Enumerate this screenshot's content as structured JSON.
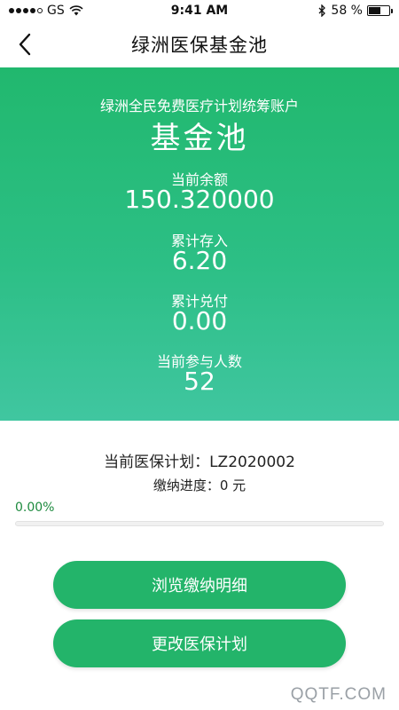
{
  "status_bar": {
    "carrier": "GS",
    "time": "9:41 AM",
    "battery": "58 %",
    "battery_level": 0.58
  },
  "nav": {
    "title": "绿洲医保基金池"
  },
  "hero": {
    "subtitle": "绿洲全民免费医疗计划统筹账户",
    "title": "基金池",
    "stats": [
      {
        "label": "当前余额",
        "value": "150.320000"
      },
      {
        "label": "累计存入",
        "value": "6.20"
      },
      {
        "label": "累计兑付",
        "value": "0.00"
      },
      {
        "label": "当前参与人数",
        "value": "52"
      }
    ]
  },
  "plan": {
    "text": "当前医保计划：LZ2020002",
    "progress_text": "缴纳进度：0 元",
    "progress_percent": "0.00%",
    "progress_value": 0
  },
  "buttons": {
    "details": "浏览缴纳明细",
    "change_plan": "更改医保计划"
  },
  "watermark": "QQTF.COM",
  "colors": {
    "primary": "#23b46a",
    "hero_top": "#21b86e",
    "hero_bottom": "#40c6a0",
    "progress_text": "#1d8a3e"
  },
  "icons": {
    "back": "chevron-left-icon",
    "wifi": "wifi-icon",
    "bluetooth": "bluetooth-icon",
    "battery": "battery-icon"
  }
}
